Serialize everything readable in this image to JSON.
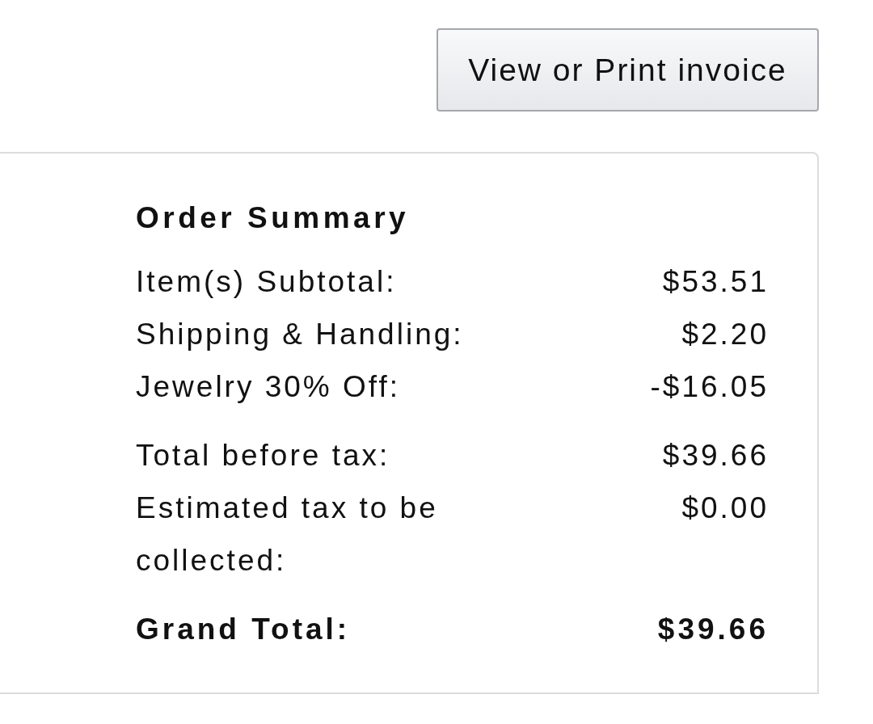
{
  "invoice_button": {
    "label": "View or Print invoice"
  },
  "order_summary": {
    "title": "Order Summary",
    "sections": [
      {
        "rows": [
          {
            "kind": "line",
            "label": "Item(s) Subtotal:",
            "value": "$53.51"
          },
          {
            "kind": "line",
            "label": "Shipping & Handling:",
            "value": "$2.20"
          },
          {
            "kind": "line",
            "label": "Jewelry 30% Off:",
            "value": "-$16.05"
          }
        ]
      },
      {
        "rows": [
          {
            "kind": "line",
            "label": "Total before tax:",
            "value": "$39.66"
          },
          {
            "kind": "line",
            "label": "Estimated tax to be collected:",
            "value": "$0.00"
          }
        ]
      },
      {
        "rows": [
          {
            "kind": "total",
            "label": "Grand Total:",
            "value": "$39.66"
          }
        ]
      }
    ]
  }
}
